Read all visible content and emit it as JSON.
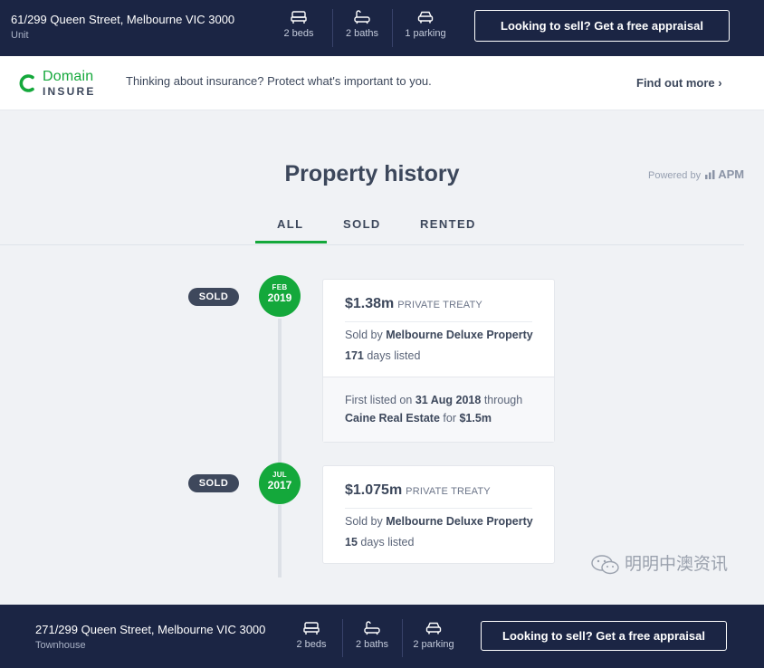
{
  "top_listing": {
    "address": "61/299 Queen Street, Melbourne VIC 3000",
    "type": "Unit",
    "beds": "2 beds",
    "baths": "2 baths",
    "parking": "1 parking",
    "cta": "Looking to sell? Get a free appraisal"
  },
  "insurance_banner": {
    "logo_word1": "Domain",
    "logo_word2": "INSURE",
    "text": "Thinking about insurance? Protect what's important to you.",
    "link": "Find out more ›"
  },
  "history": {
    "title": "Property history",
    "powered_by": "Powered by",
    "powered_brand": "APM",
    "tabs": [
      "ALL",
      "SOLD",
      "RENTED"
    ],
    "active_tab": "ALL",
    "events": [
      {
        "status": "SOLD",
        "month": "FEB",
        "year": "2019",
        "price": "$1.38m",
        "method": "PRIVATE TREATY",
        "sold_by_prefix": "Sold by",
        "agent": "Melbourne Deluxe Property",
        "days_num": "171",
        "days_suffix": "days listed",
        "first_listed": {
          "prefix": "First listed on",
          "date": "31 Aug 2018",
          "through": "through",
          "agency": "Caine Real Estate",
          "for": "for",
          "price": "$1.5m"
        }
      },
      {
        "status": "SOLD",
        "month": "JUL",
        "year": "2017",
        "price": "$1.075m",
        "method": "PRIVATE TREATY",
        "sold_by_prefix": "Sold by",
        "agent": "Melbourne Deluxe Property",
        "days_num": "15",
        "days_suffix": "days listed"
      }
    ]
  },
  "watermark": "明明中澳资讯",
  "bottom_listing": {
    "address": "271/299 Queen Street, Melbourne VIC 3000",
    "type": "Townhouse",
    "beds": "2 beds",
    "baths": "2 baths",
    "parking": "2 parking",
    "cta": "Looking to sell? Get a free appraisal"
  },
  "colors": {
    "navy": "#1b2544",
    "brand_green": "#14a83b",
    "pill_dark": "#3e485c",
    "background": "#f0f2f5"
  },
  "icons": [
    "bed-icon",
    "bath-icon",
    "car-icon",
    "domain-insure-logo-icon",
    "chevron-right-icon",
    "wechat-icon"
  ]
}
